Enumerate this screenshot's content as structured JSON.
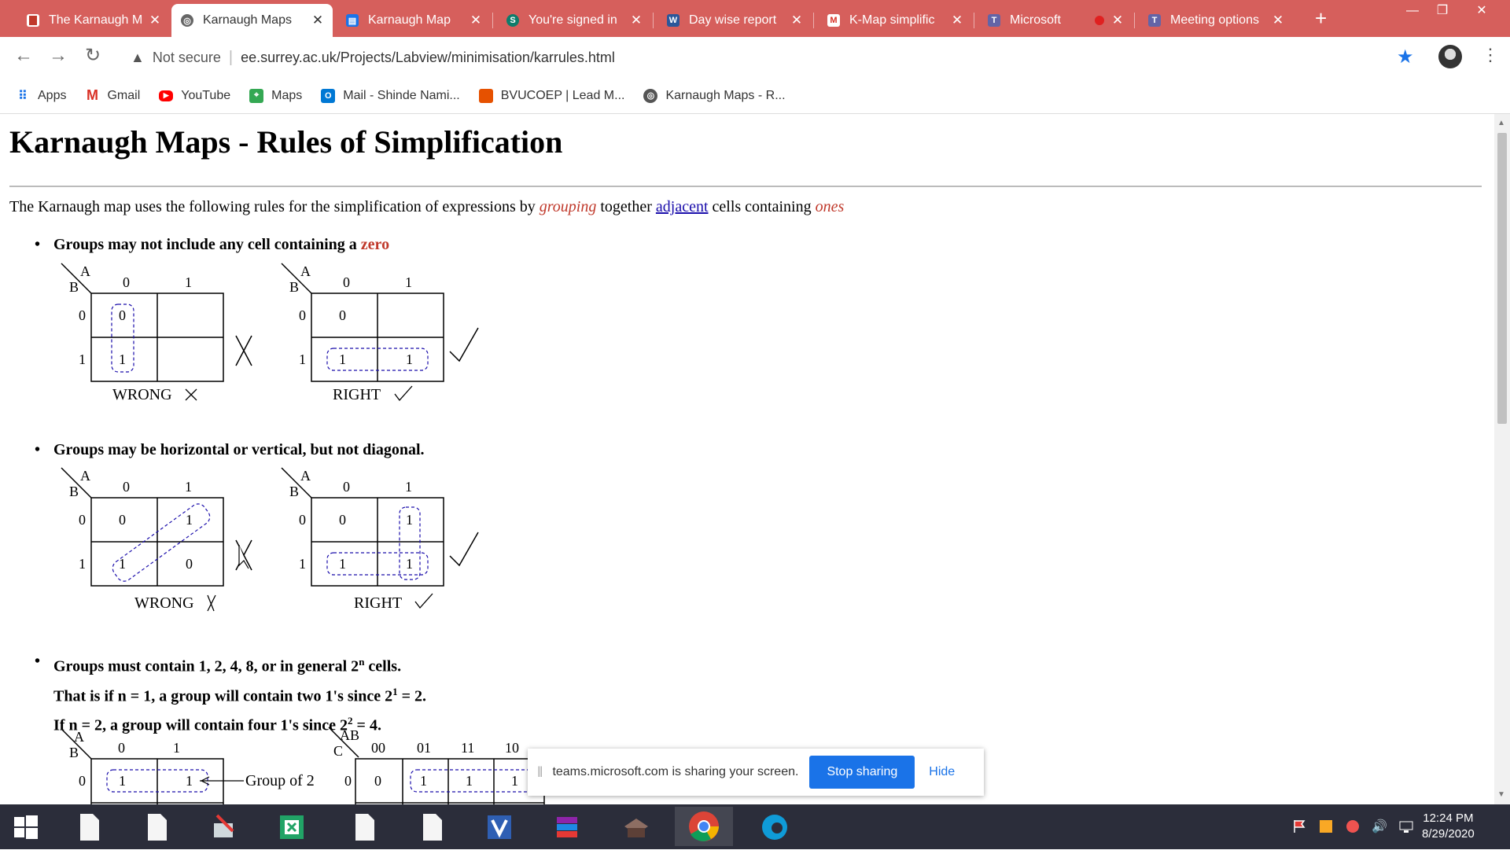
{
  "tabs": [
    {
      "title": "The Karnaugh M",
      "favicon_color": "#c0392b",
      "favicon": "page-icon"
    },
    {
      "title": "Karnaugh Maps",
      "favicon_color": "#555555",
      "favicon": "globe-icon",
      "active": true
    },
    {
      "title": "Karnaugh Map",
      "favicon_color": "#1a73e8",
      "favicon": "doc-icon"
    },
    {
      "title": "You're signed in",
      "favicon_color": "#0e7c6b",
      "favicon": "sharepoint-icon",
      "favicon_text": "S"
    },
    {
      "title": "Day wise report",
      "favicon_color": "#2b579a",
      "favicon": "word-icon",
      "favicon_text": "W"
    },
    {
      "title": "K-Map simplific",
      "favicon_color": "#ffffff",
      "favicon": "gmail-icon"
    },
    {
      "title": "Microsoft",
      "favicon_color": "#6264a7",
      "favicon": "teams-icon",
      "favicon_text": "T"
    },
    {
      "title": "Meeting options",
      "favicon_color": "#6264a7",
      "favicon": "teams-icon",
      "favicon_text": "T"
    }
  ],
  "toolbar": {
    "security_label": "Not secure",
    "url": "ee.surrey.ac.uk/Projects/Labview/minimisation/karrules.html"
  },
  "bookmarks": [
    {
      "label": "Apps",
      "icon": "apps-icon",
      "color": "#1a73e8"
    },
    {
      "label": "Gmail",
      "icon": "gmail-icon",
      "color": "#d93025"
    },
    {
      "label": "YouTube",
      "icon": "youtube-icon",
      "color": "#ff0000"
    },
    {
      "label": "Maps",
      "icon": "maps-icon",
      "color": "#34a853"
    },
    {
      "label": "Mail - Shinde Nami...",
      "icon": "outlook-icon",
      "color": "#0078d4"
    },
    {
      "label": "BVUCOEP | Lead M...",
      "icon": "bookmark-icon",
      "color": "#e65100"
    },
    {
      "label": "Karnaugh Maps - R...",
      "icon": "globe-icon",
      "color": "#555555"
    }
  ],
  "page": {
    "title": "Karnaugh Maps - Rules of Simplification",
    "intro_1": "The Karnaugh map uses the following rules for the simplification of expressions by ",
    "intro_grouping": "grouping",
    "intro_2": " together ",
    "intro_adjacent": "adjacent",
    "intro_3": " cells containing ",
    "intro_ones": "ones",
    "rule1_text": "Groups may not include any cell containing a ",
    "rule1_red": "zero",
    "rule2_text": "Groups may be horizontal or vertical, but not diagonal.",
    "rule3_line1_a": "Groups must contain 1, 2, 4, 8, or in general 2",
    "rule3_line1_sup": "n",
    "rule3_line1_b": " cells.",
    "rule3_line2_a": "That is if n = 1, a group will contain two 1's since 2",
    "rule3_line2_sup": "1",
    "rule3_line2_b": " = 2.",
    "rule3_line3_a": "If n = 2, a group will contain four 1's since 2",
    "rule3_line3_sup": "2",
    "rule3_line3_b": " = 4.",
    "wrong_label": "WRONG",
    "right_label": "RIGHT",
    "group_of_2_label": "Group of 2",
    "var_a": "A",
    "var_b": "B",
    "var_ab": "AB",
    "var_c": "C",
    "kmap1_wrong_cells": [
      "0",
      "",
      "1",
      ""
    ],
    "kmap1_right_cells": [
      "0",
      "",
      "1",
      "1"
    ],
    "kmap2_wrong_cells": [
      "0",
      "1",
      "1",
      "0"
    ],
    "kmap2_right_cells": [
      "0",
      "1",
      "1",
      "1"
    ],
    "kmap3_cells": [
      "1",
      "1"
    ],
    "kmap4_headers": [
      "00",
      "01",
      "11",
      "10"
    ],
    "kmap4_cells": [
      "0",
      "1",
      "1",
      "1"
    ]
  },
  "share_bar": {
    "message": "teams.microsoft.com is sharing your screen.",
    "stop_label": "Stop sharing",
    "hide_label": "Hide"
  },
  "clock": {
    "time": "12:24 PM",
    "date": "8/29/2020"
  }
}
